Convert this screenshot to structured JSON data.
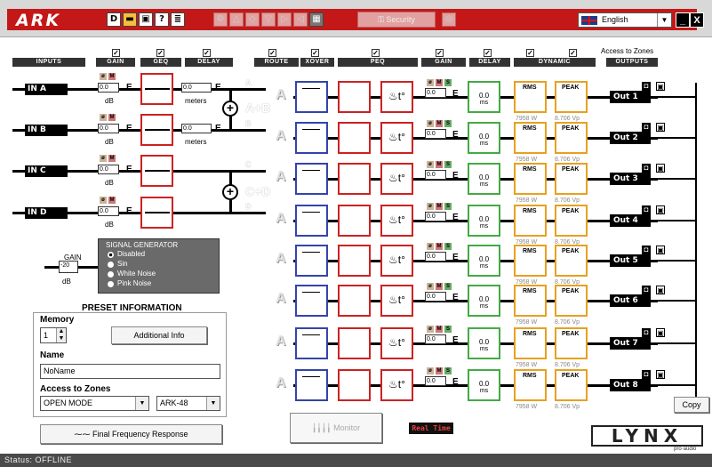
{
  "toolbar": {
    "logo": "ARK",
    "security_label": "Security",
    "language": "English",
    "minimize": "_",
    "close": "X"
  },
  "headers": {
    "inputs": "INPUTS",
    "gain": "GAIN",
    "geq": "GEQ",
    "delay": "DELAY",
    "route": "ROUTE",
    "xover": "XOVER",
    "peq": "PEQ",
    "gain2": "GAIN",
    "delay2": "DELAY",
    "dynamic": "DYNAMIC",
    "outputs": "OUTPUTS",
    "access_to_zones": "Access to Zones"
  },
  "inputs": [
    {
      "name": "IN A",
      "gain": "0.0",
      "unit": "dB",
      "delay": "0.0",
      "delay_unit": "meters",
      "route": "A"
    },
    {
      "name": "IN B",
      "gain": "0.0",
      "unit": "dB",
      "delay": "0.0",
      "delay_unit": "meters",
      "route": "B"
    },
    {
      "name": "IN C",
      "gain": "0.0",
      "unit": "dB",
      "route": "C"
    },
    {
      "name": "IN D",
      "gain": "0.0",
      "unit": "dB",
      "route": "D"
    }
  ],
  "sum_labels": [
    "A+B",
    "C+D"
  ],
  "outputs": [
    {
      "name": "Out 1",
      "route": "A",
      "gain": "0.0",
      "delay": "0.0",
      "delay_unit": "ms",
      "rms": "RMS",
      "peak": "PEAK",
      "watts": "7958 W",
      "vp": "8.706 Vp"
    },
    {
      "name": "Out 2",
      "route": "A",
      "gain": "0.0",
      "delay": "0.0",
      "delay_unit": "ms",
      "rms": "RMS",
      "peak": "PEAK",
      "watts": "7958 W",
      "vp": "8.706 Vp"
    },
    {
      "name": "Out 3",
      "route": "A",
      "gain": "0.0",
      "delay": "0.0",
      "delay_unit": "ms",
      "rms": "RMS",
      "peak": "PEAK",
      "watts": "7958 W",
      "vp": "8.706 Vp"
    },
    {
      "name": "Out 4",
      "route": "A",
      "gain": "0.0",
      "delay": "0.0",
      "delay_unit": "ms",
      "rms": "RMS",
      "peak": "PEAK",
      "watts": "7958 W",
      "vp": "8.706 Vp"
    },
    {
      "name": "Out 5",
      "route": "A",
      "gain": "0.0",
      "delay": "0.0",
      "delay_unit": "ms",
      "rms": "RMS",
      "peak": "PEAK",
      "watts": "7958 W",
      "vp": "8.706 Vp"
    },
    {
      "name": "Out 6",
      "route": "A",
      "gain": "0.0",
      "delay": "0.0",
      "delay_unit": "ms",
      "rms": "RMS",
      "peak": "PEAK",
      "watts": "7958 W",
      "vp": "8.706 Vp"
    },
    {
      "name": "Out 7",
      "route": "A",
      "gain": "0.0",
      "delay": "0.0",
      "delay_unit": "ms",
      "rms": "RMS",
      "peak": "PEAK",
      "watts": "7958 W",
      "vp": "8.706 Vp"
    },
    {
      "name": "Out 8",
      "route": "A",
      "gain": "0.0",
      "delay": "0.0",
      "delay_unit": "ms",
      "rms": "RMS",
      "peak": "PEAK",
      "watts": "7958 W",
      "vp": "8.706 Vp"
    }
  ],
  "generator": {
    "gain_label": "GAIN",
    "gain_value": "-20",
    "gain_unit": "dB",
    "title": "SIGNAL GENERATOR",
    "options": [
      "Disabled",
      "Sin",
      "White Noise",
      "Pink Noise"
    ],
    "selected": "Disabled"
  },
  "preset": {
    "title": "PRESET INFORMATION",
    "memory_label": "Memory",
    "memory_value": "1",
    "additional_info": "Additional Info",
    "name_label": "Name",
    "name_value": "NoName",
    "access_label": "Access to Zones",
    "access_value": "OPEN MODE",
    "model_value": "ARK-48"
  },
  "buttons": {
    "final_freq": "Final Frequency Response",
    "monitor": "Monitor",
    "real_time": "Real Time",
    "copy": "Copy"
  },
  "brand": "LYNX",
  "brand_sub": "pro·audio",
  "status": "Status:  OFFLINE"
}
